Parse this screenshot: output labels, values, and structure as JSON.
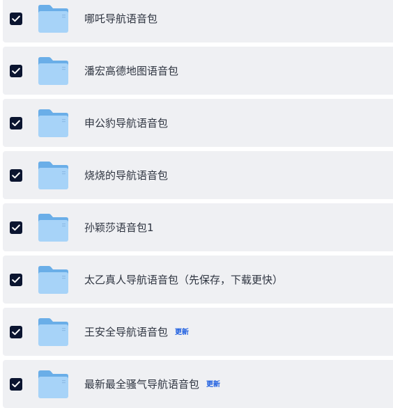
{
  "files": [
    {
      "name": "哪吒导航语音包",
      "checked": true,
      "badge": ""
    },
    {
      "name": "潘宏高德地图语音包",
      "checked": true,
      "badge": ""
    },
    {
      "name": "申公豹导航语音包",
      "checked": true,
      "badge": ""
    },
    {
      "name": "烧烧的导航语音包",
      "checked": true,
      "badge": ""
    },
    {
      "name": "孙颖莎语音包1",
      "checked": true,
      "badge": ""
    },
    {
      "name": "太乙真人导航语音包（先保存，下载更快）",
      "checked": true,
      "badge": ""
    },
    {
      "name": "王安全导航语音包",
      "checked": true,
      "badge": "更新"
    },
    {
      "name": "最新最全骚气导航语音包",
      "checked": true,
      "badge": "更新"
    }
  ],
  "icons": {
    "checkbox": "checkbox-checked-icon",
    "folder": "folder-icon"
  },
  "colors": {
    "row_background": "#eff0f3",
    "checkbox_fill": "#0b1530",
    "folder_back": "#6aaee8",
    "folder_front": "#a7d3f8",
    "badge_text": "#1f5fe0",
    "name_text": "#2e3440"
  }
}
